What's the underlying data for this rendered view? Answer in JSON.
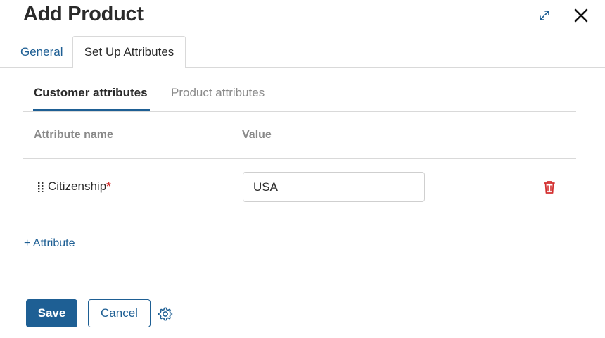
{
  "dialog": {
    "title": "Add Product"
  },
  "main_tabs": [
    {
      "label": "General",
      "active": false
    },
    {
      "label": "Set Up Attributes",
      "active": true
    }
  ],
  "sub_tabs": [
    {
      "label": "Customer attributes",
      "active": true
    },
    {
      "label": "Product attributes",
      "active": false
    }
  ],
  "table": {
    "columns": [
      "Attribute name",
      "Value"
    ],
    "rows": [
      {
        "name": "Citizenship",
        "required_mark": "*",
        "value": "USA"
      }
    ]
  },
  "add_attribute_label": "+ Attribute",
  "footer": {
    "save_label": "Save",
    "cancel_label": "Cancel"
  },
  "icons": {
    "expand": "expand-icon",
    "close": "close-icon",
    "drag": "drag-handle-icon",
    "delete": "trash-icon",
    "settings": "gear-icon"
  },
  "colors": {
    "accent": "#1e5f94",
    "danger": "#d32f2f",
    "muted": "#8a8a8a"
  }
}
